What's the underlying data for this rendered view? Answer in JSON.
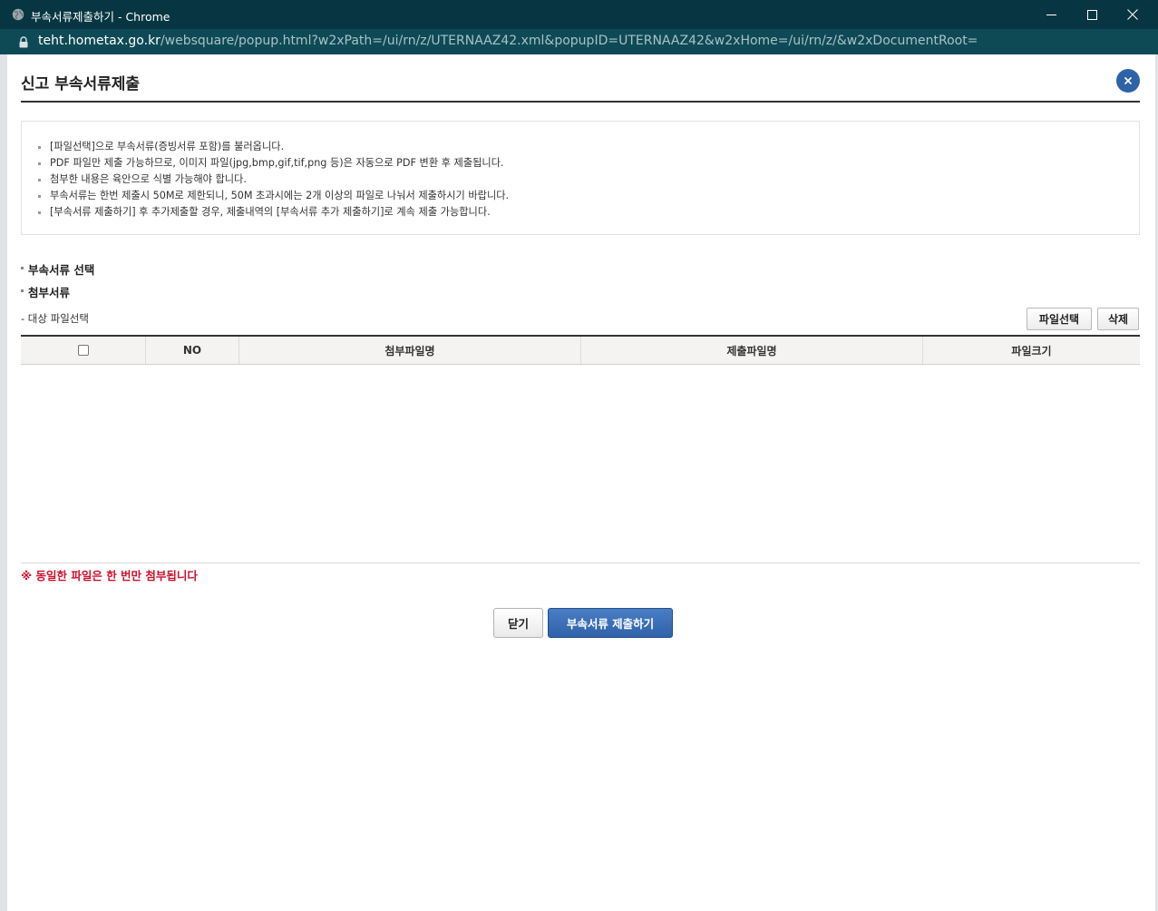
{
  "browser": {
    "window_title": "부속서류제출하기 - Chrome",
    "url_host": "teht.hometax.go.kr",
    "url_path": "/websquare/popup.html?w2xPath=/ui/rn/z/UTERNAAZ42.xml&popupID=UTERNAAZ42&w2xHome=/ui/rn/z/&w2xDocumentRoot=",
    "titlebar_color": "#073642"
  },
  "page": {
    "title": "신고 부속서류제출",
    "close_icon": "close-icon"
  },
  "notice": {
    "items": [
      "[파일선택]으로 부속서류(증빙서류 포함)를 불러옵니다.",
      "PDF 파일만 제출 가능하므로, 이미지 파일(jpg,bmp,gif,tif,png 등)은 자동으로 PDF 변환 후 제출됩니다.",
      "첨부한 내용은 육안으로 식별 가능해야 합니다.",
      "부속서류는 한번 제출시 50M로 제한되니, 50M 초과시에는 2개 이상의 파일로 나눠서 제출하시기 바랍니다.",
      "[부속서류 제출하기] 후 추가제출할 경우, 제출내역의 [부속서류 추가 제출하기]로 계속 제출 가능합니다."
    ]
  },
  "sections": {
    "select_label": "부속서류 선택",
    "attach_label": "첨부서류",
    "target_label": "- 대상 파일선택"
  },
  "toolbar": {
    "file_select_label": "파일선택",
    "delete_label": "삭제"
  },
  "grid": {
    "columns": [
      "NO",
      "첨부파일명",
      "제출파일명",
      "파일크기"
    ],
    "rows": []
  },
  "warning": "※ 동일한 파일은 한 번만 첨부됩니다",
  "footer": {
    "close_label": "닫기",
    "submit_label": "부속서류 제출하기",
    "submit_color": "#2f62a8",
    "warning_color": "#d0112b"
  }
}
